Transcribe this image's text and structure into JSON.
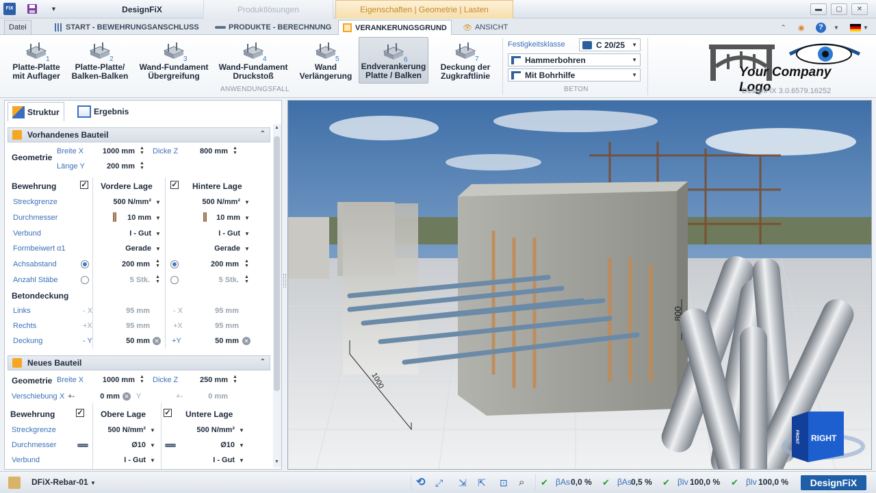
{
  "titlebar": {
    "app_name": "DesignFiX",
    "context_tab_1": "Produktlösungen",
    "context_tab_2": "Eigenschaften | Geometrie | Lasten",
    "qa_logo": "FiX"
  },
  "ribbon_tabs": {
    "file": "Datei",
    "start": "START - BEWEHRUNGSANSCHLUSS",
    "products": "PRODUKTE - BERECHNUNG",
    "anchorage": "VERANKERUNGSGRUND",
    "view": "ANSICHT"
  },
  "ribbon": {
    "cases": [
      {
        "num": "1",
        "line1": "Platte-Platte",
        "line2": "mit Auflager"
      },
      {
        "num": "2",
        "line1": "Platte-Platte/",
        "line2": "Balken-Balken"
      },
      {
        "num": "3",
        "line1": "Wand-Fundament",
        "line2": "Übergreifung"
      },
      {
        "num": "4",
        "line1": "Wand-Fundament",
        "line2": "Druckstoß"
      },
      {
        "num": "5",
        "line1": "Wand",
        "line2": "Verlängerung"
      },
      {
        "num": "6",
        "line1": "Endverankerung",
        "line2": "Platte / Balken"
      },
      {
        "num": "7",
        "line1": "Deckung der",
        "line2": "Zugkraftlinie"
      }
    ],
    "group_anwendungsfall": "ANWENDUNGSFALL",
    "festigkeitsklasse_label": "Festigkeitsklasse",
    "festigkeitsklasse_value": "C 20/25",
    "bohrverfahren": "Hammerbohren",
    "bohrhilfe": "Mit Bohrhilfe",
    "group_beton": "BETON",
    "logo_text": "Your Company Logo",
    "version": "DesignFiX 3.0.6579.16252"
  },
  "panel_tabs": {
    "struktur": "Struktur",
    "ergebnis": "Ergebnis"
  },
  "vorhandenes": {
    "title": "Vorhandenes Bauteil",
    "geometrie": "Geometrie",
    "breite_x_label": "Breite X",
    "breite_x": "1000 mm",
    "dicke_z_label": "Dicke Z",
    "dicke_z": "800 mm",
    "laenge_y_label": "Länge Y",
    "laenge_y": "200 mm",
    "bewehrung": "Bewehrung",
    "vordere_lage": "Vordere Lage",
    "hintere_lage": "Hintere Lage",
    "streckgrenze_label": "Streckgrenze",
    "streckgrenze_v": "500 N/mm²",
    "streckgrenze_h": "500 N/mm²",
    "durchmesser_label": "Durchmesser",
    "durchmesser_v": "10 mm",
    "durchmesser_h": "10 mm",
    "verbund_label": "Verbund",
    "verbund_v": "I - Gut",
    "verbund_h": "I - Gut",
    "formbeiwert_label": "Formbeiwert α1",
    "formbeiwert_v": "Gerade",
    "formbeiwert_h": "Gerade",
    "achsabstand_label": "Achsabstand",
    "achsabstand_v": "200 mm",
    "achsabstand_h": "200 mm",
    "anzahl_label": "Anzahl Stäbe",
    "anzahl_v": "5 Stk.",
    "anzahl_h": "5 Stk.",
    "betondeckung": "Betondeckung",
    "links_label": "Links",
    "links_v_sign": "- X",
    "links_v": "95 mm",
    "links_h_sign": "- X",
    "links_h": "95 mm",
    "rechts_label": "Rechts",
    "rechts_v_sign": "+X",
    "rechts_v": "95 mm",
    "rechts_h_sign": "+X",
    "rechts_h": "95 mm",
    "deckung_label": "Deckung",
    "deckung_v_sign": "- Y",
    "deckung_v": "50 mm",
    "deckung_h_sign": "+Y",
    "deckung_h": "50 mm"
  },
  "neues": {
    "title": "Neues Bauteil",
    "geometrie": "Geometrie",
    "breite_x_label": "Breite X",
    "breite_x": "1000 mm",
    "dicke_z_label": "Dicke Z",
    "dicke_z": "250 mm",
    "verschiebung_label": "Verschiebung",
    "x_label": "X",
    "x_pm": "+-",
    "x_value": "0 mm",
    "y_label": "Y",
    "y_pm": "+-",
    "y_value": "0 mm",
    "bewehrung": "Bewehrung",
    "obere_lage": "Obere Lage",
    "untere_lage": "Untere Lage",
    "streckgrenze_label": "Streckgrenze",
    "streckgrenze_o": "500 N/mm²",
    "streckgrenze_u": "500 N/mm²",
    "durchmesser_label": "Durchmesser",
    "durchmesser_o": "Ø10",
    "durchmesser_u": "Ø10",
    "verbund_label": "Verbund",
    "verbund_o": "I - Gut",
    "verbund_u": "I - Gut"
  },
  "viewport": {
    "dim_800": "800",
    "dim_1000": "1000",
    "cube_label": "RIGHT",
    "cube_front": "FRONT"
  },
  "statusbar": {
    "project": "DFiX-Rebar-01",
    "beta_as_1_label": "βAs",
    "beta_as_1": "0,0 %",
    "beta_as_2_label": "βAs",
    "beta_as_2": "0,5 %",
    "beta_lv_1_label": "βlv",
    "beta_lv_1": "100,0 %",
    "beta_lv_2_label": "βlv",
    "beta_lv_2": "100,0 %",
    "brand": "DesignFiX"
  },
  "colors": {
    "accent": "#f5a623",
    "link_label": "#3a70b8",
    "brand": "#1f5fa8"
  }
}
